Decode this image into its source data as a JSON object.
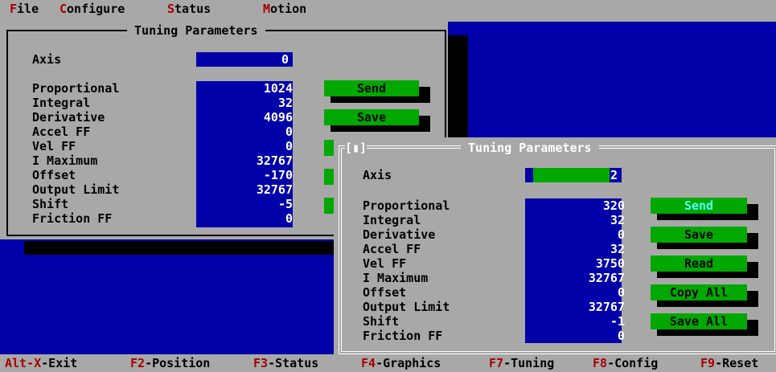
{
  "menu": {
    "items": [
      {
        "hot": "F",
        "rest": "ile"
      },
      {
        "hot": "C",
        "rest": "onfigure"
      },
      {
        "hot": "S",
        "rest": "tatus"
      },
      {
        "hot": "M",
        "rest": "otion"
      }
    ]
  },
  "win1": {
    "title": " Tuning Parameters ",
    "axis_label": "Axis",
    "axis_value": "0",
    "params": [
      {
        "label": "Proportional",
        "value": "1024"
      },
      {
        "label": "Integral",
        "value": "32"
      },
      {
        "label": "Derivative",
        "value": "4096"
      },
      {
        "label": "Accel FF",
        "value": "0"
      },
      {
        "label": "Vel FF",
        "value": "0"
      },
      {
        "label": "I Maximum",
        "value": "32767"
      },
      {
        "label": "Offset",
        "value": "-170"
      },
      {
        "label": "Output Limit",
        "value": "32767"
      },
      {
        "label": "Shift",
        "value": "-5"
      },
      {
        "label": "Friction FF",
        "value": "0"
      }
    ],
    "send_label": "Send",
    "save_label": "Save"
  },
  "win2": {
    "close_box": "[▮]",
    "title": " Tuning Parameters ",
    "axis_label": "Axis",
    "axis_value": "2",
    "params": [
      {
        "label": "Proportional",
        "value": "320"
      },
      {
        "label": "Integral",
        "value": "32"
      },
      {
        "label": "Derivative",
        "value": "0"
      },
      {
        "label": "Accel FF",
        "value": "32"
      },
      {
        "label": "Vel FF",
        "value": "3750"
      },
      {
        "label": "I Maximum",
        "value": "32767"
      },
      {
        "label": "Offset",
        "value": "0"
      },
      {
        "label": "Output Limit",
        "value": "32767"
      },
      {
        "label": "Shift",
        "value": "-1"
      },
      {
        "label": "Friction FF",
        "value": "0"
      }
    ],
    "buttons": {
      "send": "Send",
      "save": "Save",
      "read": "Read",
      "copy_all": "Copy All",
      "save_all": "Save All"
    }
  },
  "statusbar": {
    "items": [
      {
        "key": "Alt-X",
        "text": "-Exit"
      },
      {
        "key": "F2",
        "text": "-Position"
      },
      {
        "key": "F3",
        "text": "-Status"
      },
      {
        "key": "F4",
        "text": "-Graphics"
      },
      {
        "key": "F7",
        "text": "-Tuning"
      },
      {
        "key": "F8",
        "text": "-Config"
      },
      {
        "key": "F9",
        "text": "-Reset"
      }
    ]
  },
  "colors": {
    "desktop": "#0000a8",
    "panel": "#a8a8a8",
    "field": "#0000a8",
    "button": "#00a800",
    "hotkey": "#a80000",
    "focus_text": "#55ffff"
  }
}
